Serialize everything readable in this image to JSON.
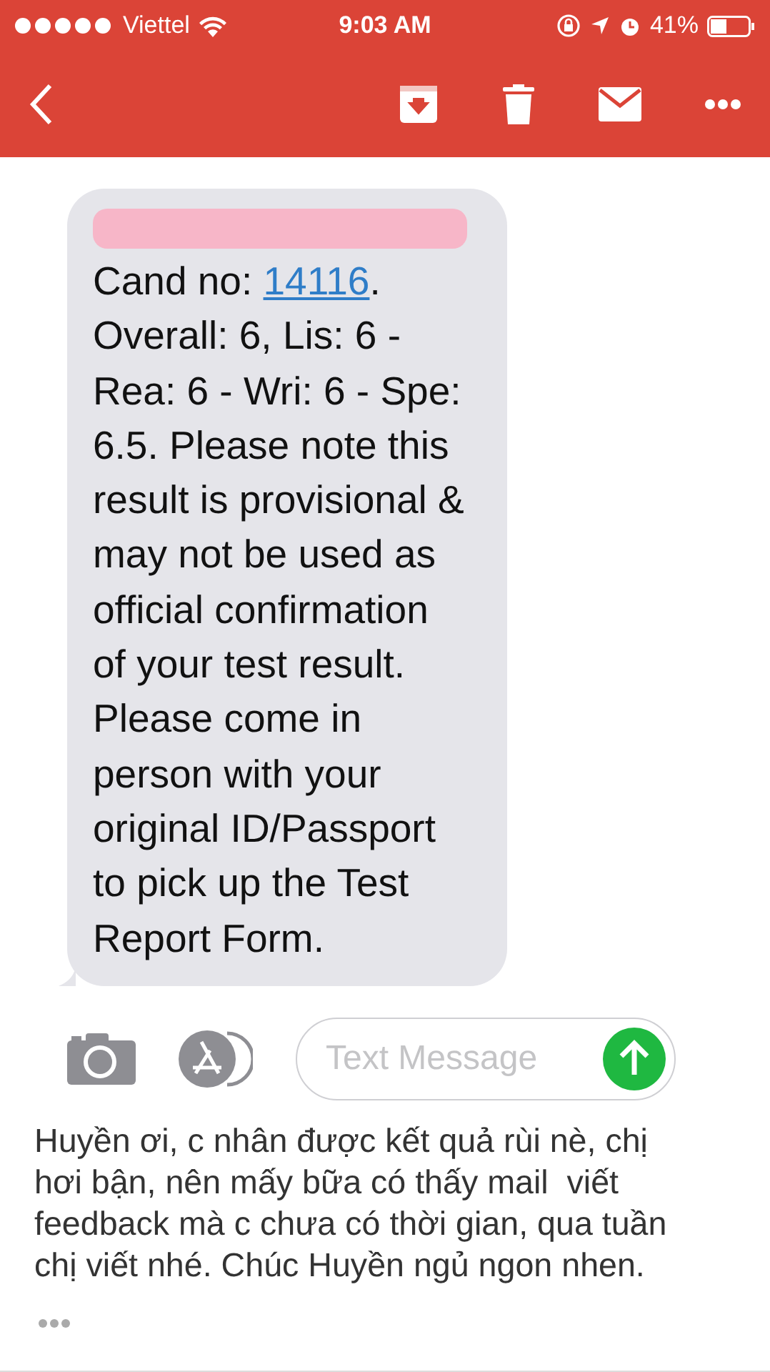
{
  "status_bar": {
    "carrier": "Viettel",
    "time": "9:03 AM",
    "battery": "41%"
  },
  "sms": {
    "redacted": true,
    "before_link": "Cand no: ",
    "link": "14116",
    "after_link": ". Overall: 6, Lis: 6 - Rea: 6 - Wri: 6 - Spe: 6.5. Please note this result is provisional & may not be used as official confirmation of your test result. Please come in person with your original ID/Passport to pick up the Test Report Form."
  },
  "composer": {
    "placeholder": "Text Message"
  },
  "email_body": "Huyền ơi, c nhân được kết quả rùi nè, chị hơi bận, nên mấy bữa có thấy mail  viết feedback mà c chưa có thời gian, qua tuần chị viết nhé. Chúc Huyền ngủ ngon nhen."
}
